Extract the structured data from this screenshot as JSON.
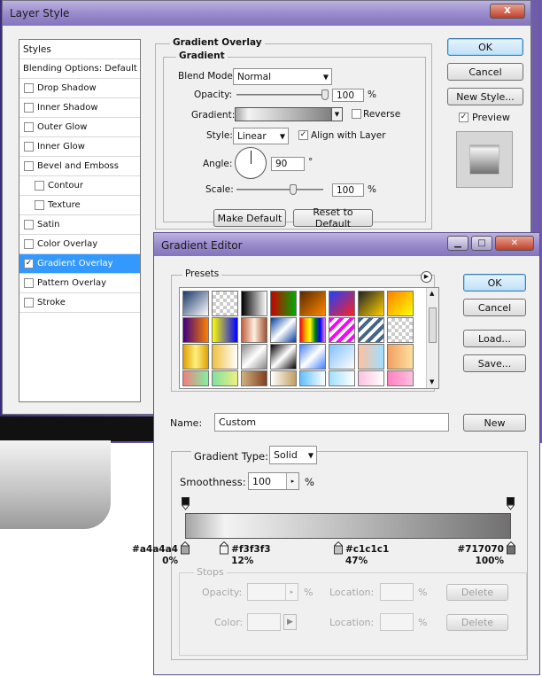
{
  "layer_style": {
    "title": "Layer Style",
    "window_buttons": {
      "close": "X"
    },
    "styles_list": [
      {
        "label": "Styles",
        "type": "header"
      },
      {
        "label": "Blending Options: Default",
        "type": "header"
      },
      {
        "label": "Drop Shadow",
        "checked": false
      },
      {
        "label": "Inner Shadow",
        "checked": false
      },
      {
        "label": "Outer Glow",
        "checked": false
      },
      {
        "label": "Inner Glow",
        "checked": false
      },
      {
        "label": "Bevel and Emboss",
        "checked": false
      },
      {
        "label": "Contour",
        "checked": false,
        "sub": true
      },
      {
        "label": "Texture",
        "checked": false,
        "sub": true
      },
      {
        "label": "Satin",
        "checked": false
      },
      {
        "label": "Color Overlay",
        "checked": false
      },
      {
        "label": "Gradient Overlay",
        "checked": true,
        "selected": true
      },
      {
        "label": "Pattern Overlay",
        "checked": false
      },
      {
        "label": "Stroke",
        "checked": false
      }
    ],
    "panel": {
      "group_title": "Gradient Overlay",
      "subgroup_title": "Gradient",
      "blend_mode_label": "Blend Mode:",
      "blend_mode_value": "Normal",
      "opacity_label": "Opacity:",
      "opacity_value": "100",
      "opacity_unit": "%",
      "opacity_fraction": 1.0,
      "gradient_label": "Gradient:",
      "reverse_label": "Reverse",
      "reverse_checked": false,
      "style_label": "Style:",
      "style_value": "Linear",
      "align_label": "Align with Layer",
      "align_checked": true,
      "angle_label": "Angle:",
      "angle_value": "90",
      "angle_unit": "°",
      "scale_label": "Scale:",
      "scale_value": "100",
      "scale_unit": "%",
      "scale_fraction": 0.65,
      "make_default": "Make Default",
      "reset_default": "Reset to Default"
    },
    "buttons": {
      "ok": "OK",
      "cancel": "Cancel",
      "new_style": "New Style...",
      "preview_label": "Preview",
      "preview_checked": true
    }
  },
  "gradient_editor": {
    "title": "Gradient Editor",
    "presets_label": "Presets",
    "buttons": {
      "ok": "OK",
      "cancel": "Cancel",
      "load": "Load...",
      "save": "Save...",
      "new": "New"
    },
    "name_label": "Name:",
    "name_value": "Custom",
    "gradient_type_label": "Gradient Type:",
    "gradient_type_value": "Solid",
    "smoothness_label": "Smoothness:",
    "smoothness_value": "100",
    "smoothness_unit": "%",
    "color_stops": [
      {
        "color": "#a4a4a4",
        "label": "#a4a4a4",
        "percent_label": "0%",
        "location": 0
      },
      {
        "color": "#f3f3f3",
        "label": "#f3f3f3",
        "percent_label": "12%",
        "location": 12
      },
      {
        "color": "#c1c1c1",
        "label": "#c1c1c1",
        "percent_label": "47%",
        "location": 47
      },
      {
        "color": "#717070",
        "label": "#717070",
        "percent_label": "100%",
        "location": 100
      }
    ],
    "stops": {
      "title": "Stops",
      "opacity_label": "Opacity:",
      "opacity_unit": "%",
      "location_label": "Location:",
      "location_unit": "%",
      "delete_label": "Delete",
      "color_label": "Color:"
    }
  },
  "colors": {
    "accent": "#3399ff",
    "title_bar": "#9a8bcd"
  }
}
